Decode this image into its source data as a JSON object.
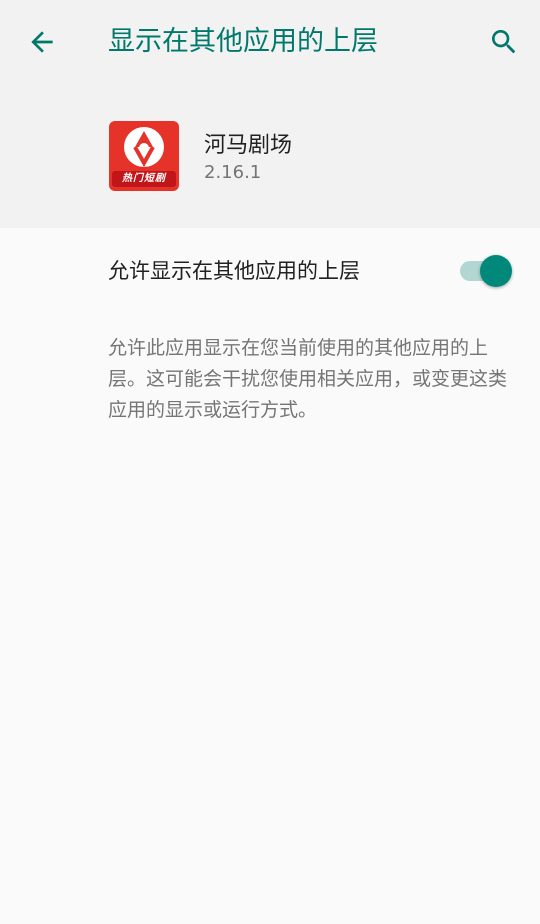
{
  "header": {
    "title": "显示在其他应用的上层",
    "back_icon": "arrow-left-icon",
    "search_icon": "search-icon",
    "accent_color": "#00796b"
  },
  "app": {
    "name": "河马剧场",
    "version": "2.16.1",
    "icon_badge": "热门短剧",
    "icon_color": "#e6332a"
  },
  "setting": {
    "label": "允许显示在其他应用的上层",
    "enabled": true,
    "switch_color": "#00897b"
  },
  "description": "允许此应用显示在您当前使用的其他应用的上层。这可能会干扰您使用相关应用，或变更这类应用的显示或运行方式。"
}
